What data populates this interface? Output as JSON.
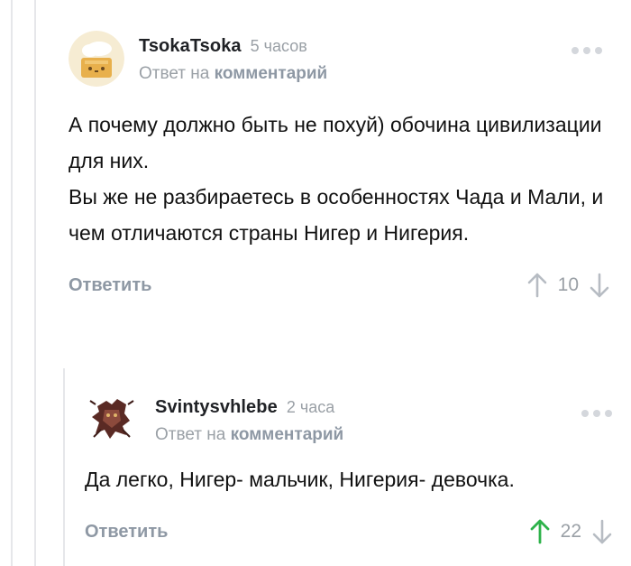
{
  "comments": [
    {
      "username": "TsokaTsoka",
      "time": "5 часов",
      "reply_prefix": "Ответ на",
      "reply_link": "комментарий",
      "paragraphs": [
        "А почему должно быть не похуй) обочина цивилизации для них.",
        "Вы же не разбираетесь в особенностях Чада и Мали, и чем отличаются страны Нигер и Нигерия."
      ],
      "reply_label": "Ответить",
      "rating": "10",
      "upvoted": false
    },
    {
      "username": "Svintysvhlebe",
      "time": "2 часа",
      "reply_prefix": "Ответ на",
      "reply_link": "комментарий",
      "paragraphs": [
        "Да легко, Нигер- мальчик, Нигерия- девочка."
      ],
      "reply_label": "Ответить",
      "rating": "22",
      "upvoted": true
    }
  ],
  "colors": {
    "muted": "#9aa0a6",
    "link": "#8e98a4",
    "upvote_active": "#2db24a",
    "arrow_inactive": "#b7bcc3"
  }
}
